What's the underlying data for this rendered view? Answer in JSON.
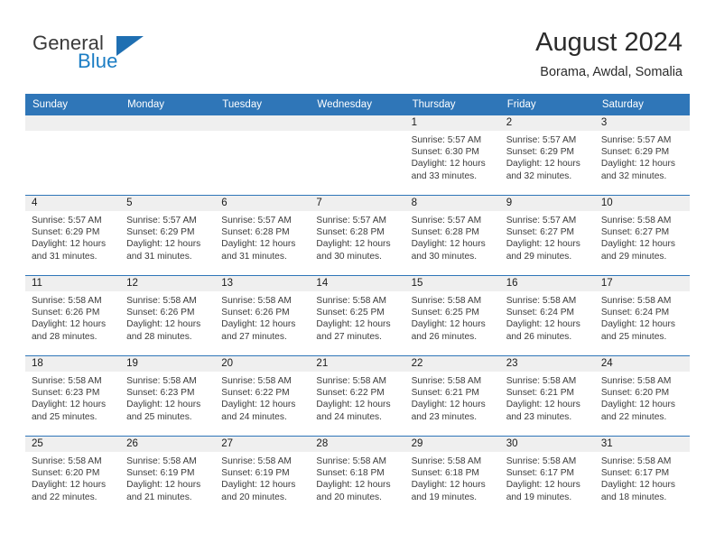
{
  "brand": {
    "name_part1": "General",
    "name_part2": "Blue",
    "logo_icon": "blue-triangle-icon",
    "accent_color": "#1f6fb2"
  },
  "header": {
    "title": "August 2024",
    "subtitle": "Borama, Awdal, Somalia"
  },
  "theme": {
    "header_bar_color": "#2f76b8",
    "daynum_strip_color": "#efefef",
    "text_color": "#3b3b3b"
  },
  "weekday_headers": [
    "Sunday",
    "Monday",
    "Tuesday",
    "Wednesday",
    "Thursday",
    "Friday",
    "Saturday"
  ],
  "weeks": [
    {
      "days": [
        {
          "day": "",
          "empty": true,
          "sunrise": "",
          "sunset": "",
          "daylight_line1": "",
          "daylight_line2": ""
        },
        {
          "day": "",
          "empty": true,
          "sunrise": "",
          "sunset": "",
          "daylight_line1": "",
          "daylight_line2": ""
        },
        {
          "day": "",
          "empty": true,
          "sunrise": "",
          "sunset": "",
          "daylight_line1": "",
          "daylight_line2": ""
        },
        {
          "day": "",
          "empty": true,
          "sunrise": "",
          "sunset": "",
          "daylight_line1": "",
          "daylight_line2": ""
        },
        {
          "day": "1",
          "empty": false,
          "sunrise": "Sunrise: 5:57 AM",
          "sunset": "Sunset: 6:30 PM",
          "daylight_line1": "Daylight: 12 hours",
          "daylight_line2": "and 33 minutes."
        },
        {
          "day": "2",
          "empty": false,
          "sunrise": "Sunrise: 5:57 AM",
          "sunset": "Sunset: 6:29 PM",
          "daylight_line1": "Daylight: 12 hours",
          "daylight_line2": "and 32 minutes."
        },
        {
          "day": "3",
          "empty": false,
          "sunrise": "Sunrise: 5:57 AM",
          "sunset": "Sunset: 6:29 PM",
          "daylight_line1": "Daylight: 12 hours",
          "daylight_line2": "and 32 minutes."
        }
      ]
    },
    {
      "days": [
        {
          "day": "4",
          "empty": false,
          "sunrise": "Sunrise: 5:57 AM",
          "sunset": "Sunset: 6:29 PM",
          "daylight_line1": "Daylight: 12 hours",
          "daylight_line2": "and 31 minutes."
        },
        {
          "day": "5",
          "empty": false,
          "sunrise": "Sunrise: 5:57 AM",
          "sunset": "Sunset: 6:29 PM",
          "daylight_line1": "Daylight: 12 hours",
          "daylight_line2": "and 31 minutes."
        },
        {
          "day": "6",
          "empty": false,
          "sunrise": "Sunrise: 5:57 AM",
          "sunset": "Sunset: 6:28 PM",
          "daylight_line1": "Daylight: 12 hours",
          "daylight_line2": "and 31 minutes."
        },
        {
          "day": "7",
          "empty": false,
          "sunrise": "Sunrise: 5:57 AM",
          "sunset": "Sunset: 6:28 PM",
          "daylight_line1": "Daylight: 12 hours",
          "daylight_line2": "and 30 minutes."
        },
        {
          "day": "8",
          "empty": false,
          "sunrise": "Sunrise: 5:57 AM",
          "sunset": "Sunset: 6:28 PM",
          "daylight_line1": "Daylight: 12 hours",
          "daylight_line2": "and 30 minutes."
        },
        {
          "day": "9",
          "empty": false,
          "sunrise": "Sunrise: 5:57 AM",
          "sunset": "Sunset: 6:27 PM",
          "daylight_line1": "Daylight: 12 hours",
          "daylight_line2": "and 29 minutes."
        },
        {
          "day": "10",
          "empty": false,
          "sunrise": "Sunrise: 5:58 AM",
          "sunset": "Sunset: 6:27 PM",
          "daylight_line1": "Daylight: 12 hours",
          "daylight_line2": "and 29 minutes."
        }
      ]
    },
    {
      "days": [
        {
          "day": "11",
          "empty": false,
          "sunrise": "Sunrise: 5:58 AM",
          "sunset": "Sunset: 6:26 PM",
          "daylight_line1": "Daylight: 12 hours",
          "daylight_line2": "and 28 minutes."
        },
        {
          "day": "12",
          "empty": false,
          "sunrise": "Sunrise: 5:58 AM",
          "sunset": "Sunset: 6:26 PM",
          "daylight_line1": "Daylight: 12 hours",
          "daylight_line2": "and 28 minutes."
        },
        {
          "day": "13",
          "empty": false,
          "sunrise": "Sunrise: 5:58 AM",
          "sunset": "Sunset: 6:26 PM",
          "daylight_line1": "Daylight: 12 hours",
          "daylight_line2": "and 27 minutes."
        },
        {
          "day": "14",
          "empty": false,
          "sunrise": "Sunrise: 5:58 AM",
          "sunset": "Sunset: 6:25 PM",
          "daylight_line1": "Daylight: 12 hours",
          "daylight_line2": "and 27 minutes."
        },
        {
          "day": "15",
          "empty": false,
          "sunrise": "Sunrise: 5:58 AM",
          "sunset": "Sunset: 6:25 PM",
          "daylight_line1": "Daylight: 12 hours",
          "daylight_line2": "and 26 minutes."
        },
        {
          "day": "16",
          "empty": false,
          "sunrise": "Sunrise: 5:58 AM",
          "sunset": "Sunset: 6:24 PM",
          "daylight_line1": "Daylight: 12 hours",
          "daylight_line2": "and 26 minutes."
        },
        {
          "day": "17",
          "empty": false,
          "sunrise": "Sunrise: 5:58 AM",
          "sunset": "Sunset: 6:24 PM",
          "daylight_line1": "Daylight: 12 hours",
          "daylight_line2": "and 25 minutes."
        }
      ]
    },
    {
      "days": [
        {
          "day": "18",
          "empty": false,
          "sunrise": "Sunrise: 5:58 AM",
          "sunset": "Sunset: 6:23 PM",
          "daylight_line1": "Daylight: 12 hours",
          "daylight_line2": "and 25 minutes."
        },
        {
          "day": "19",
          "empty": false,
          "sunrise": "Sunrise: 5:58 AM",
          "sunset": "Sunset: 6:23 PM",
          "daylight_line1": "Daylight: 12 hours",
          "daylight_line2": "and 25 minutes."
        },
        {
          "day": "20",
          "empty": false,
          "sunrise": "Sunrise: 5:58 AM",
          "sunset": "Sunset: 6:22 PM",
          "daylight_line1": "Daylight: 12 hours",
          "daylight_line2": "and 24 minutes."
        },
        {
          "day": "21",
          "empty": false,
          "sunrise": "Sunrise: 5:58 AM",
          "sunset": "Sunset: 6:22 PM",
          "daylight_line1": "Daylight: 12 hours",
          "daylight_line2": "and 24 minutes."
        },
        {
          "day": "22",
          "empty": false,
          "sunrise": "Sunrise: 5:58 AM",
          "sunset": "Sunset: 6:21 PM",
          "daylight_line1": "Daylight: 12 hours",
          "daylight_line2": "and 23 minutes."
        },
        {
          "day": "23",
          "empty": false,
          "sunrise": "Sunrise: 5:58 AM",
          "sunset": "Sunset: 6:21 PM",
          "daylight_line1": "Daylight: 12 hours",
          "daylight_line2": "and 23 minutes."
        },
        {
          "day": "24",
          "empty": false,
          "sunrise": "Sunrise: 5:58 AM",
          "sunset": "Sunset: 6:20 PM",
          "daylight_line1": "Daylight: 12 hours",
          "daylight_line2": "and 22 minutes."
        }
      ]
    },
    {
      "days": [
        {
          "day": "25",
          "empty": false,
          "sunrise": "Sunrise: 5:58 AM",
          "sunset": "Sunset: 6:20 PM",
          "daylight_line1": "Daylight: 12 hours",
          "daylight_line2": "and 22 minutes."
        },
        {
          "day": "26",
          "empty": false,
          "sunrise": "Sunrise: 5:58 AM",
          "sunset": "Sunset: 6:19 PM",
          "daylight_line1": "Daylight: 12 hours",
          "daylight_line2": "and 21 minutes."
        },
        {
          "day": "27",
          "empty": false,
          "sunrise": "Sunrise: 5:58 AM",
          "sunset": "Sunset: 6:19 PM",
          "daylight_line1": "Daylight: 12 hours",
          "daylight_line2": "and 20 minutes."
        },
        {
          "day": "28",
          "empty": false,
          "sunrise": "Sunrise: 5:58 AM",
          "sunset": "Sunset: 6:18 PM",
          "daylight_line1": "Daylight: 12 hours",
          "daylight_line2": "and 20 minutes."
        },
        {
          "day": "29",
          "empty": false,
          "sunrise": "Sunrise: 5:58 AM",
          "sunset": "Sunset: 6:18 PM",
          "daylight_line1": "Daylight: 12 hours",
          "daylight_line2": "and 19 minutes."
        },
        {
          "day": "30",
          "empty": false,
          "sunrise": "Sunrise: 5:58 AM",
          "sunset": "Sunset: 6:17 PM",
          "daylight_line1": "Daylight: 12 hours",
          "daylight_line2": "and 19 minutes."
        },
        {
          "day": "31",
          "empty": false,
          "sunrise": "Sunrise: 5:58 AM",
          "sunset": "Sunset: 6:17 PM",
          "daylight_line1": "Daylight: 12 hours",
          "daylight_line2": "and 18 minutes."
        }
      ]
    }
  ]
}
